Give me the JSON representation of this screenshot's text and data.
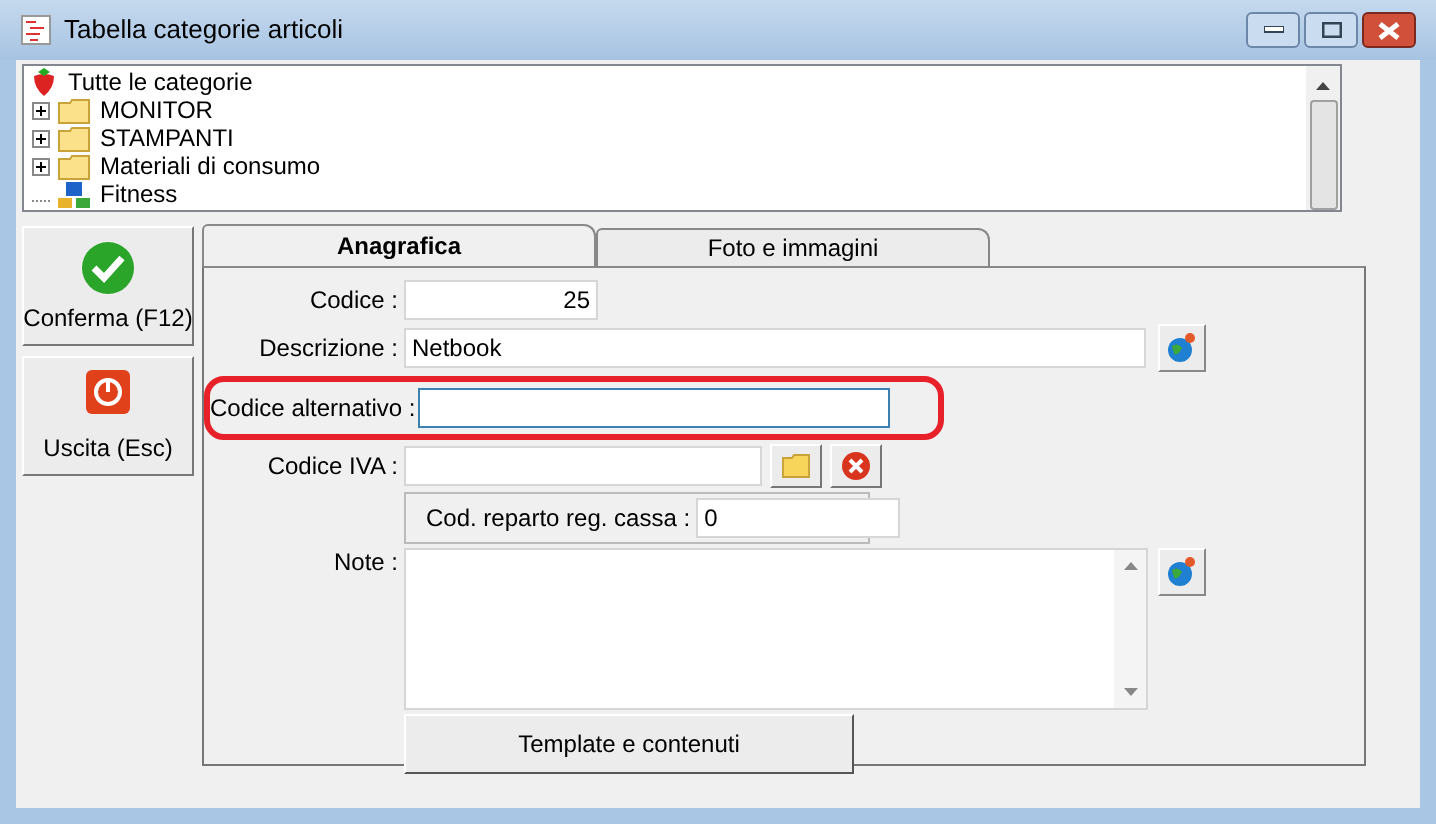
{
  "window": {
    "title": "Tabella categorie articoli"
  },
  "tree": {
    "root": {
      "label": "Tutte le categorie"
    },
    "children": [
      {
        "label": "MONITOR",
        "kind": "folder",
        "expanded": false
      },
      {
        "label": "STAMPANTI",
        "kind": "folder",
        "expanded": false
      },
      {
        "label": "Materiali di consumo",
        "kind": "folder",
        "expanded": false
      },
      {
        "label": "Fitness",
        "kind": "leaf"
      }
    ]
  },
  "side_buttons": [
    {
      "label": "Conferma (F12)",
      "kind": "confirm"
    },
    {
      "label": "Uscita (Esc)",
      "kind": "exit"
    }
  ],
  "tabs": [
    {
      "label": "Anagrafica",
      "selected": true
    },
    {
      "label": "Foto e immagini",
      "selected": false
    }
  ],
  "form": {
    "codice": {
      "label": "Codice :",
      "value": "25"
    },
    "descrizione": {
      "label": "Descrizione :",
      "value": "Netbook"
    },
    "codice_alternativo": {
      "label": "Codice alternativo :",
      "focused": true,
      "highlighted": true
    },
    "codice_iva": {
      "label": "Codice IVA :"
    },
    "reparto": {
      "label": "Cod. reparto reg. cassa :",
      "value": "0"
    },
    "note": {
      "label": "Note :"
    },
    "template_button": "Template e contenuti"
  }
}
